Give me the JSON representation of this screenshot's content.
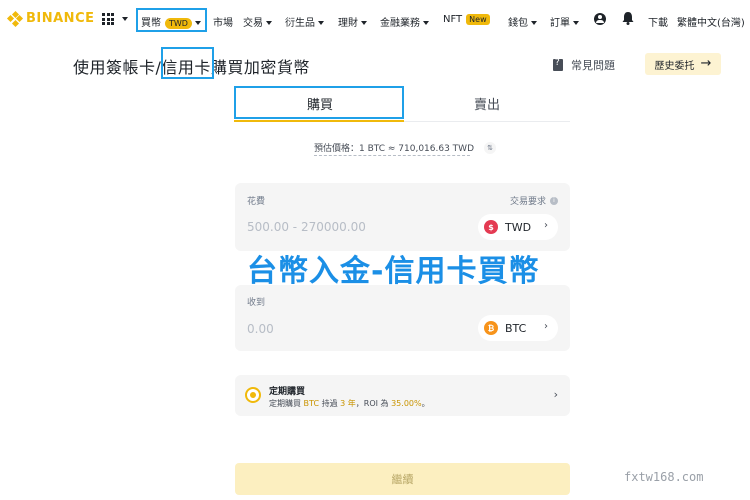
{
  "nav": {
    "logo": "BINANCE",
    "buy": "買幣",
    "buy_badge": "TWD",
    "market": "市場",
    "trade": "交易",
    "derivatives": "衍生品",
    "finance": "理財",
    "financial_services": "金融業務",
    "nft": "NFT",
    "nft_badge": "New",
    "wallet": "錢包",
    "orders": "訂單",
    "download": "下載",
    "language": "繁體中文(台灣)"
  },
  "header": {
    "title_prefix": "使用簽帳卡/",
    "title_highlight": "信用卡",
    "title_suffix": "購買加密貨幣",
    "faq": "常見問題",
    "history": "歷史委托"
  },
  "tabs": {
    "buy": "購買",
    "sell": "賣出"
  },
  "estimate": "預估價格：1 BTC ≈ 710,016.63 TWD",
  "spend": {
    "label": "花費",
    "requirement": "交易要求",
    "placeholder": "500.00 - 270000.00",
    "currency": "TWD",
    "currency_symbol": "$"
  },
  "overlay": "台幣入金-信用卡買幣",
  "receive": {
    "label": "收到",
    "value": "0.00",
    "currency": "BTC",
    "currency_symbol": "₿"
  },
  "recurring": {
    "title": "定期購買",
    "desc_1": "定期購買 ",
    "desc_coin": "BTC",
    "desc_2": " 持過 ",
    "desc_years": "3 年",
    "desc_3": "，ROI 為 ",
    "desc_roi": "35.00%",
    "desc_4": "。"
  },
  "continue": "繼續",
  "watermark": "fxtw168.com",
  "colors": {
    "accent": "#f0b90b",
    "highlight_box": "#1fa0e8",
    "overlay_text": "#1b8fe6"
  }
}
